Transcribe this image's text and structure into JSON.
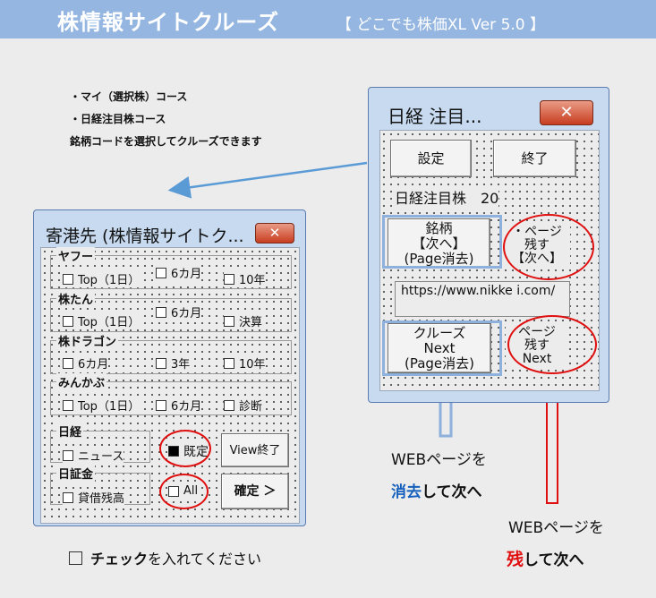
{
  "banner": {
    "title": "株情報サイトクルーズ",
    "subtitle": "【 どこでも株価XL  Ver 5.0 】"
  },
  "notes": [
    "・マイ（選択株）コース",
    "・日経注目株コース",
    "銘柄コードを選択してクルーズできます"
  ],
  "right_dialog": {
    "title": "日経 注目...",
    "settings_button": "設定",
    "exit_button": "終了",
    "stock_label": "日経注目株　20",
    "brand_button": "銘柄\n【次へ】\n(Page消去)",
    "brand_note": "・ページ\n残す\n【次へ】",
    "url": "https://www.nikke i.com/",
    "cruise_button": "クルーズ\nNext\n(Page消去)",
    "cruise_note": "ページ\n残す\nNext"
  },
  "left_dialog": {
    "title": "寄港先 (株情報サイトク...",
    "groups": [
      {
        "label": "ヤフー",
        "options": [
          "Top（1日）",
          "6カ月",
          "10年"
        ]
      },
      {
        "label": "株たん",
        "options": [
          "Top（1日）",
          "6カ月",
          "決算"
        ]
      },
      {
        "label": "株ドラゴン",
        "options": [
          "6カ月",
          "3年",
          "10年"
        ]
      },
      {
        "label": "みんかぶ",
        "options": [
          "Top（1日）",
          "6カ月",
          "診断"
        ]
      }
    ],
    "nikkei": {
      "label": "日経",
      "option": "ニュース"
    },
    "nikkei_kin": {
      "label": "日証金",
      "option": "貸借残高"
    },
    "default_option": "既定",
    "all_option": "All",
    "view_exit_button": "View終了",
    "confirm_button": "確定 ＞"
  },
  "captions": {
    "erase_prefix": "WEBページを",
    "erase_main": "消去",
    "erase_suffix": "して次へ",
    "keep_prefix": "WEBページを",
    "keep_main": "残",
    "keep_suffix": "して次へ",
    "erase_color": "#1560bd",
    "keep_color": "#e01010"
  },
  "check_hint": {
    "bold": "チェック",
    "rest": "を入れてください"
  }
}
